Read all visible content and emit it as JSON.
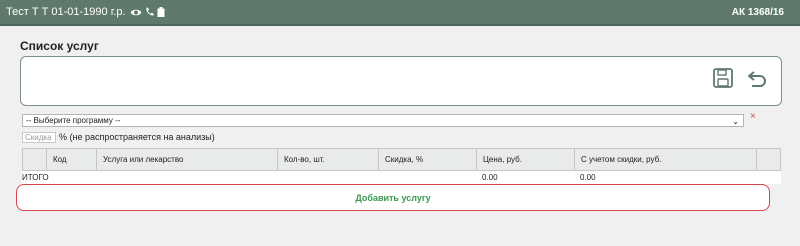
{
  "header": {
    "patient": "Тест Т Т 01-01-1990 г.р.",
    "code": "АК 1368/16",
    "icons": [
      "eye-icon",
      "phone-icon",
      "clipboard-icon"
    ]
  },
  "services": {
    "title": "Список услуг",
    "icons": [
      "save-icon",
      "undo-icon"
    ]
  },
  "program": {
    "placeholder": "-- Выберите программу --",
    "clear_symbol": "×"
  },
  "discount": {
    "placeholder": "Скидка",
    "note": "% (не распространяется на анализы)"
  },
  "table": {
    "headers": [
      "",
      "Код",
      "Услуга или лекарство",
      "Кол-во, шт.",
      "Скидка, %",
      "Цена, руб.",
      "С учетом скидки, руб.",
      ""
    ],
    "total": {
      "label": "ИТОГО",
      "price": "0.00",
      "discounted": "0.00"
    }
  },
  "add_service_label": "Добавить услугу",
  "colors": {
    "header_bg": "#5f7a6c",
    "add_text": "#3a9a4f",
    "highlight_border": "#d6464a",
    "clear_x": "#d34a4a"
  }
}
